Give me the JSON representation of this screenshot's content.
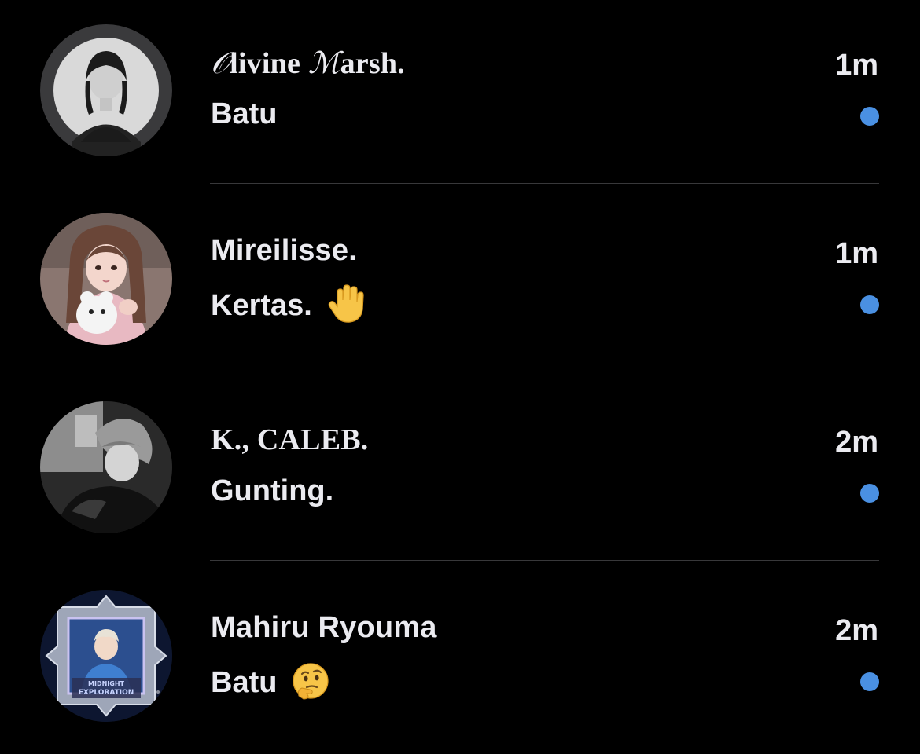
{
  "accent_color": "#4a90e2",
  "conversations": [
    {
      "name_script_1": "𝒪",
      "name_mid": "livine ",
      "name_script_2": "ℳ",
      "name_end": "arsh.",
      "preview": "Batu",
      "time": "1m",
      "unread": true,
      "avatar_icon": "avatar-photo-bw-girl"
    },
    {
      "name": "Mireilisse.",
      "preview": "Kertas.",
      "emoji_icon": "raised-hand-emoji",
      "time": "1m",
      "unread": true,
      "avatar_icon": "avatar-photo-girl-plush"
    },
    {
      "name": "K., CALEB.",
      "preview": "Gunting.",
      "time": "2m",
      "unread": true,
      "avatar_icon": "avatar-photo-bw-boy"
    },
    {
      "name": "Mahiru Ryouma",
      "preview": "Batu",
      "emoji_icon": "thinking-face-emoji",
      "time": "2m",
      "unread": true,
      "avatar_icon": "avatar-game-frame"
    }
  ]
}
